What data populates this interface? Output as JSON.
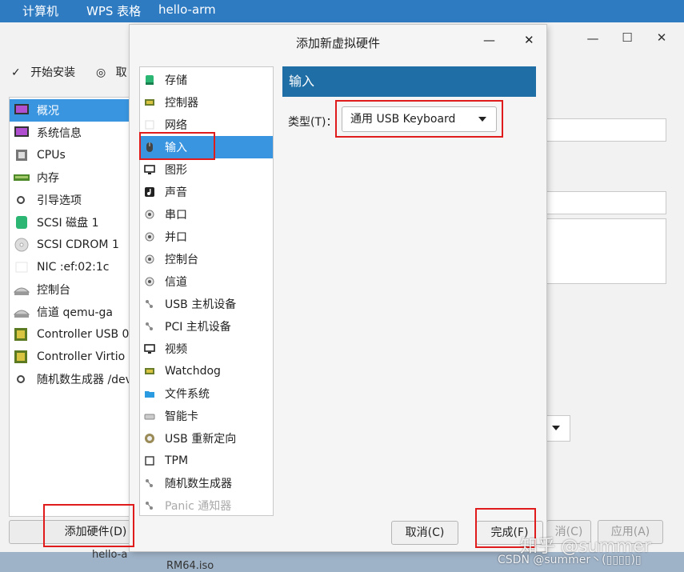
{
  "taskbar": {
    "items": [
      "计算机",
      "WPS 表格",
      "hello-arm"
    ]
  },
  "vm_window": {
    "toolbar": {
      "begin_install": "开始安装",
      "cancel_partial": "取"
    },
    "left_items": [
      {
        "label": "概况",
        "icon": "overview-icon",
        "selected": true
      },
      {
        "label": "系统信息",
        "icon": "sysinfo-icon"
      },
      {
        "label": "CPUs",
        "icon": "cpu-icon"
      },
      {
        "label": "内存",
        "icon": "memory-icon"
      },
      {
        "label": "引导选项",
        "icon": "boot-gear-icon"
      },
      {
        "label": "SCSI 磁盘 1",
        "icon": "disk-icon"
      },
      {
        "label": "SCSI CDROM 1",
        "icon": "cdrom-icon"
      },
      {
        "label": "NIC :ef:02:1c",
        "icon": "nic-icon"
      },
      {
        "label": "控制台",
        "icon": "console-icon"
      },
      {
        "label": "信道 qemu-ga",
        "icon": "channel-icon"
      },
      {
        "label": "Controller USB 0",
        "icon": "controller-icon"
      },
      {
        "label": "Controller Virtio SC",
        "icon": "controller-icon"
      },
      {
        "label": "随机数生成器 /dev",
        "icon": "rng-gear-icon"
      }
    ],
    "add_hardware": "添加硬件(D)",
    "cancel_partial": "消(C)",
    "apply": "应用(A)"
  },
  "dialog": {
    "title": "添加新虚拟硬件",
    "hardware_list": [
      {
        "label": "存储",
        "icon": "storage-icon"
      },
      {
        "label": "控制器",
        "icon": "controller-icon"
      },
      {
        "label": "网络",
        "icon": "network-icon"
      },
      {
        "label": "输入",
        "icon": "mouse-icon",
        "selected": true
      },
      {
        "label": "图形",
        "icon": "monitor-icon"
      },
      {
        "label": "声音",
        "icon": "sound-icon"
      },
      {
        "label": "串口",
        "icon": "serial-icon"
      },
      {
        "label": "并口",
        "icon": "parallel-icon"
      },
      {
        "label": "控制台",
        "icon": "console-icon"
      },
      {
        "label": "信道",
        "icon": "channel-icon"
      },
      {
        "label": "USB 主机设备",
        "icon": "usb-icon"
      },
      {
        "label": "PCI 主机设备",
        "icon": "pci-icon"
      },
      {
        "label": "视频",
        "icon": "video-icon"
      },
      {
        "label": "Watchdog",
        "icon": "watchdog-icon"
      },
      {
        "label": "文件系统",
        "icon": "folder-icon"
      },
      {
        "label": "智能卡",
        "icon": "smartcard-icon"
      },
      {
        "label": "USB 重新定向",
        "icon": "usb-redirect-icon"
      },
      {
        "label": "TPM",
        "icon": "tpm-icon"
      },
      {
        "label": "随机数生成器",
        "icon": "rng-icon"
      },
      {
        "label": "Panic 通知器",
        "icon": "panic-icon",
        "disabled": true
      }
    ],
    "section_header": "输入",
    "type_label": "类型(T)：",
    "type_value": "通用 USB Keyboard",
    "cancel": "取消(C)",
    "finish": "完成(F)"
  },
  "watermark": {
    "zhihu": "知乎 @summer",
    "csdn": "CSDN @summer丶(▯▯▯▯)▯"
  },
  "desktop_partial": [
    "hello-a",
    "RM64.iso"
  ],
  "colors": {
    "selection": "#3a95e0",
    "section_header": "#1f6fa6",
    "highlight_box": "#e01b1b",
    "taskbar": "#2f7bc2"
  }
}
